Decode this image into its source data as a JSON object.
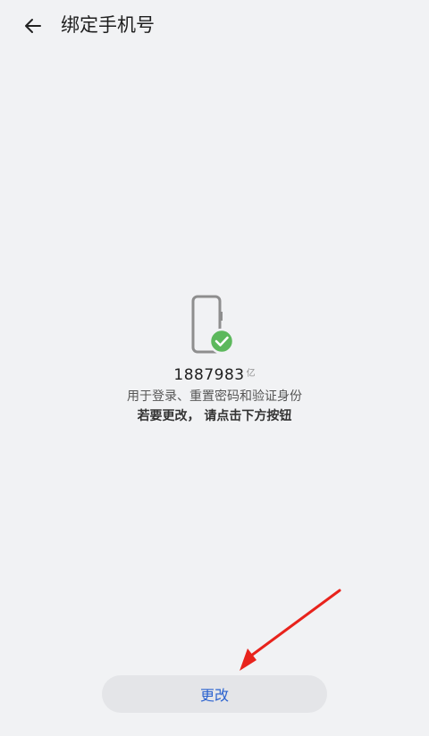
{
  "header": {
    "title": "绑定手机号",
    "back_icon": "back-arrow-icon"
  },
  "main": {
    "phone_icon": "phone-verified-icon",
    "phone_number": "1887983",
    "phone_number_tail": "亿",
    "description": "用于登录、重置密码和验证身份",
    "hint": "若要更改， 请点击下方按钮"
  },
  "actions": {
    "change_label": "更改"
  },
  "colors": {
    "background": "#f1f2f4",
    "accent": "#2a62cf",
    "check": "#5cb85c",
    "annotation_arrow": "#e8231c"
  }
}
